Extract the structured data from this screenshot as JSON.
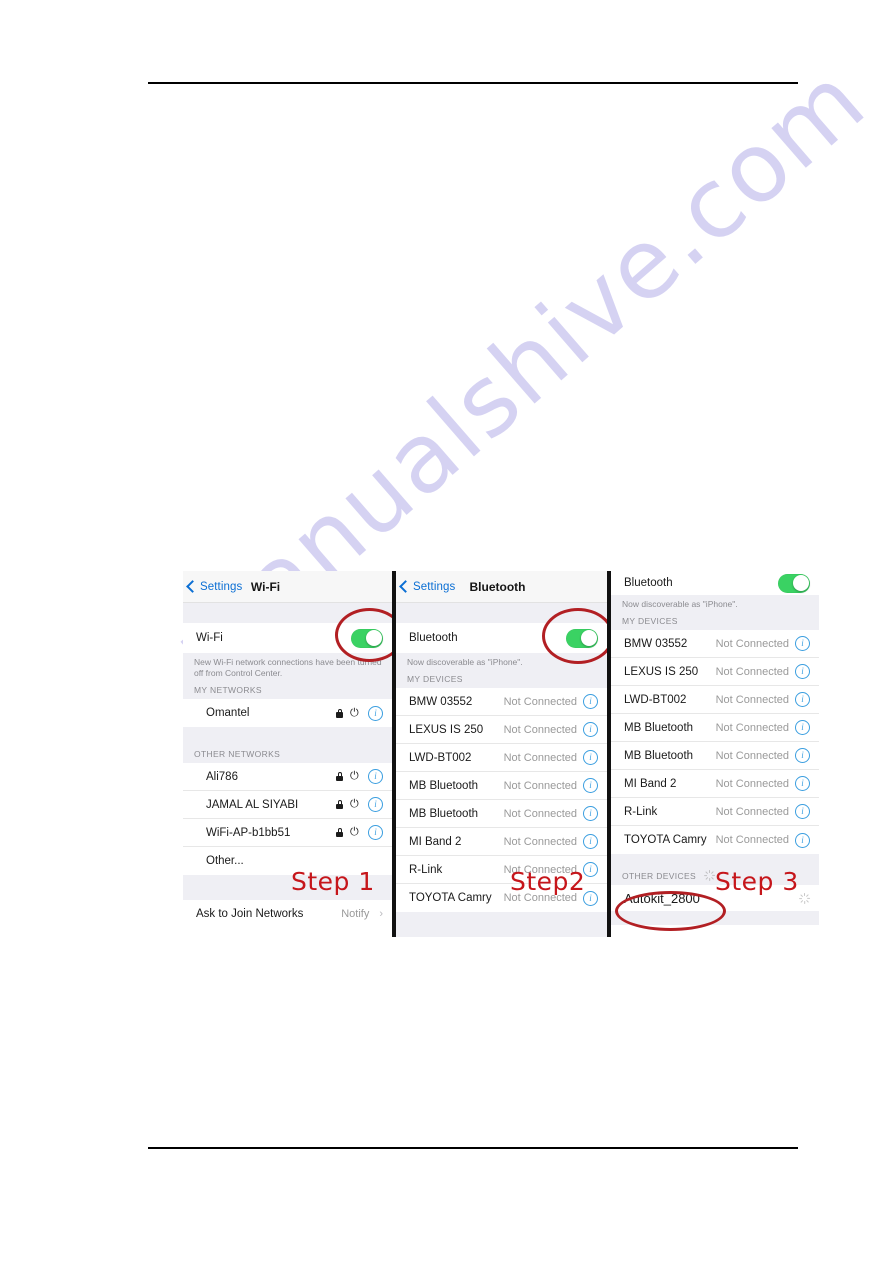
{
  "watermark": {
    "text": "manualshive.com"
  },
  "annotations": {
    "step1": "Step 1",
    "step2": "Step2",
    "step3": "Step 3"
  },
  "panels": [
    {
      "id": "wifi",
      "nav": {
        "back_label": "Settings",
        "title": "Wi-Fi"
      },
      "toggle": {
        "label": "Wi-Fi",
        "state": "on"
      },
      "note": "New Wi-Fi network connections have been turned off from Control Center.",
      "sections": [
        {
          "header": "MY NETWORKS",
          "rows": [
            {
              "name": "Omantel",
              "secured": true,
              "signal": true,
              "info": true
            }
          ]
        },
        {
          "header": "OTHER NETWORKS",
          "rows": [
            {
              "name": "Ali786",
              "secured": true,
              "signal": true,
              "info": true
            },
            {
              "name": "JAMAL AL SIYABI",
              "secured": true,
              "signal": true,
              "info": true
            },
            {
              "name": "WiFi-AP-b1bb51",
              "secured": true,
              "signal": true,
              "info": true
            },
            {
              "name": "Other...",
              "secured": false,
              "signal": false,
              "info": false
            }
          ]
        }
      ],
      "footer_row": {
        "label": "Ask to Join Networks",
        "value": "Notify"
      }
    },
    {
      "id": "bluetooth",
      "nav": {
        "back_label": "Settings",
        "title": "Bluetooth"
      },
      "toggle": {
        "label": "Bluetooth",
        "state": "on"
      },
      "note": "Now discoverable as \"iPhone\".",
      "sections": [
        {
          "header": "MY DEVICES",
          "rows": [
            {
              "name": "BMW 03552",
              "status": "Not Connected"
            },
            {
              "name": "LEXUS IS 250",
              "status": "Not Connected"
            },
            {
              "name": "LWD-BT002",
              "status": "Not Connected"
            },
            {
              "name": "MB Bluetooth",
              "status": "Not Connected"
            },
            {
              "name": "MB Bluetooth",
              "status": "Not Connected"
            },
            {
              "name": "MI Band 2",
              "status": "Not Connected"
            },
            {
              "name": "R-Link",
              "status": "Not Connected"
            },
            {
              "name": "TOYOTA Camry",
              "status": "Not Connected"
            }
          ]
        }
      ]
    },
    {
      "id": "bluetooth-scan",
      "toggle": {
        "label": "Bluetooth",
        "state": "on"
      },
      "note": "Now discoverable as \"iPhone\".",
      "sections": [
        {
          "header": "MY DEVICES",
          "rows": [
            {
              "name": "BMW 03552",
              "status": "Not Connected"
            },
            {
              "name": "LEXUS IS 250",
              "status": "Not Connected"
            },
            {
              "name": "LWD-BT002",
              "status": "Not Connected"
            },
            {
              "name": "MB Bluetooth",
              "status": "Not Connected"
            },
            {
              "name": "MB Bluetooth",
              "status": "Not Connected"
            },
            {
              "name": "MI Band 2",
              "status": "Not Connected"
            },
            {
              "name": "R-Link",
              "status": "Not Connected"
            },
            {
              "name": "TOYOTA Camry",
              "status": "Not Connected"
            }
          ]
        },
        {
          "header": "OTHER DEVICES",
          "rows": [
            {
              "name": "Autokit_2800",
              "status": "",
              "spinner": true
            }
          ]
        }
      ]
    }
  ],
  "colors": {
    "accent_blue": "#0b6fd4",
    "toggle_green": "#3ad263",
    "marker_red": "#b21f23",
    "step_red": "#c6161b",
    "watermark": "#c5c2ee",
    "ios_group_bg": "#efeff4"
  }
}
